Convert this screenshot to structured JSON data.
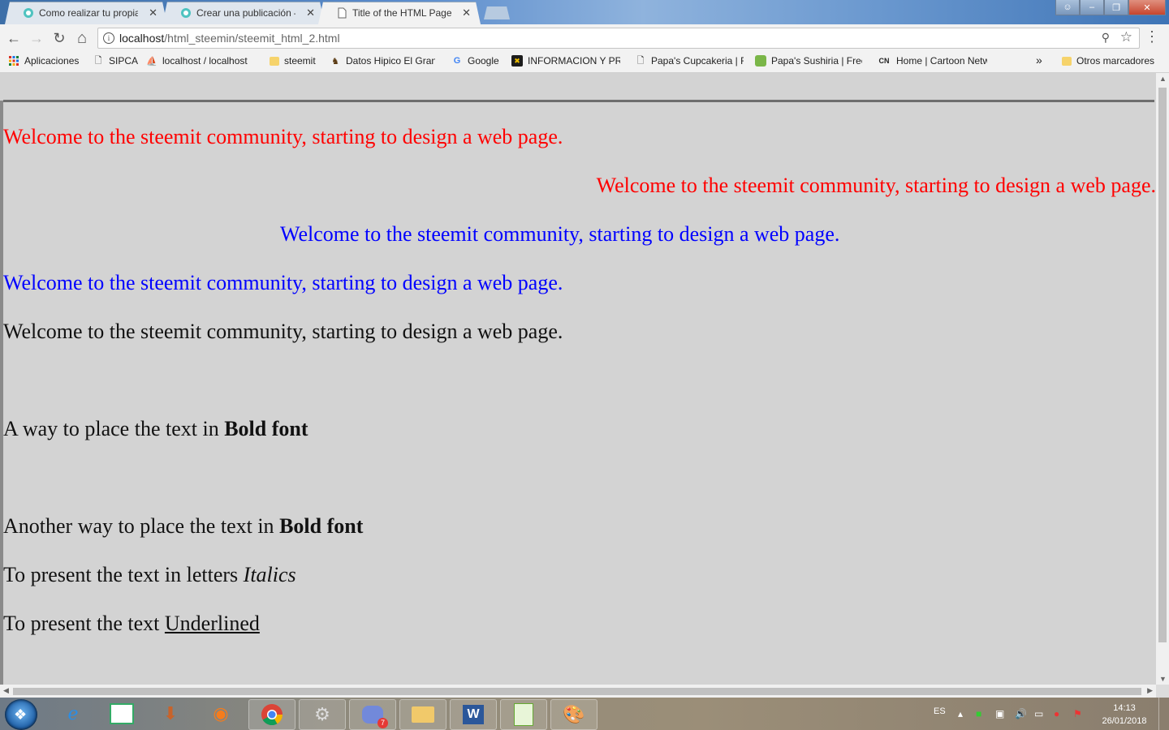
{
  "tabs": [
    {
      "title": "Como realizar tu propia p",
      "active": false
    },
    {
      "title": "Crear una publicación —",
      "active": false
    },
    {
      "title": "Title of the HTML Page",
      "active": true
    }
  ],
  "tab_close_glyph": "✕",
  "toolbar": {
    "back_glyph": "←",
    "forward_glyph": "→",
    "reload_glyph": "↻",
    "home_glyph": "⌂",
    "url_host": "localhost",
    "url_path": "/html_steemin/steemit_html_2.html",
    "zoom_glyph": "⚲",
    "star_glyph": "☆",
    "menu_glyph": "⋮"
  },
  "bookmarks": {
    "apps_label": "Aplicaciones",
    "items": [
      {
        "label": "SIPCA",
        "icon": "page-icon"
      },
      {
        "label": "localhost / localhost",
        "icon": "phpmyadmin-icon"
      },
      {
        "label": "steemit",
        "icon": "folder-icon"
      },
      {
        "label": "Datos Hipico El Gran",
        "icon": "horse-icon"
      },
      {
        "label": "Google",
        "icon": "google-icon"
      },
      {
        "label": "INFORMACION Y PR",
        "icon": "info-icon"
      },
      {
        "label": "Papa's Cupcakeria | F",
        "icon": "page-icon"
      },
      {
        "label": "Papa's Sushiria | Free",
        "icon": "game-icon"
      },
      {
        "label": "Home | Cartoon Netw",
        "icon": "cn-icon"
      }
    ],
    "more_glyph": "»",
    "other_label": "Otros marcadores"
  },
  "content": {
    "line1": "Welcome to the steemit community, starting to design a web page.",
    "line2": "Welcome to the steemit community, starting to design a web page.",
    "line3": "Welcome to the steemit community, starting to design a web page.",
    "line4": "Welcome to the steemit community, starting to design a web page.",
    "line5": "Welcome to the steemit community, starting to design a web page.",
    "bold1_prefix": "A way to place the text in ",
    "bold1_emph": "Bold font",
    "bold2_prefix": "Another way to place the text in ",
    "bold2_emph": "Bold font",
    "italic_prefix": "To present the text in letters ",
    "italic_emph": "Italics",
    "underline_prefix": "To present the text ",
    "underline_emph": "Underlined"
  },
  "colors": {
    "red": "#ff0000",
    "blue": "#0000ff",
    "page_bg": "#d3d3d3"
  },
  "taskbar": {
    "apps": [
      "internet-explorer-icon",
      "notepad-icon",
      "mp3-icon",
      "firefox-icon",
      "chrome-icon",
      "settings-icon",
      "discord-icon",
      "file-explorer-icon",
      "word-icon",
      "editor-icon",
      "paint-icon"
    ],
    "discord_badge": "7",
    "language": "ES",
    "time": "14:13",
    "date": "26/01/2018"
  }
}
